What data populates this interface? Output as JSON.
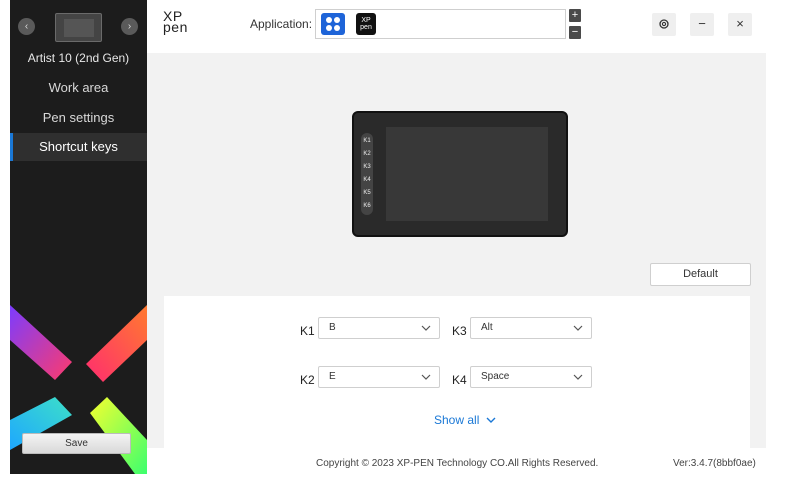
{
  "device": {
    "name": "Artist 10 (2nd Gen)",
    "prev_icon": "chevron-left-icon",
    "next_icon": "chevron-right-icon"
  },
  "sidebar": {
    "items": [
      {
        "label": "Work area",
        "active": false
      },
      {
        "label": "Pen settings",
        "active": false
      },
      {
        "label": "Shortcut keys",
        "active": true
      }
    ],
    "save_label": "Save"
  },
  "header": {
    "logo_line1": "XP",
    "logo_line2": "pen",
    "application_label": "Application:",
    "apps": [
      {
        "icon": "all-applications-icon"
      },
      {
        "icon": "xppen-app-icon",
        "text_line1": "XP",
        "text_line2": "pen"
      }
    ],
    "add_symbol": "+",
    "remove_symbol": "−",
    "settings_icon": "gear-icon",
    "minimize_symbol": "−",
    "close_symbol": "×"
  },
  "tablet": {
    "keys": [
      "K1",
      "K2",
      "K3",
      "K4",
      "K5",
      "K6"
    ]
  },
  "default_label": "Default",
  "shortcuts": {
    "k1": {
      "label": "K1",
      "value": "B"
    },
    "k2": {
      "label": "K2",
      "value": "E"
    },
    "k3": {
      "label": "K3",
      "value": "Alt"
    },
    "k4": {
      "label": "K4",
      "value": "Space"
    },
    "show_all_label": "Show all"
  },
  "footer": {
    "copyright": "Copyright © 2023  XP-PEN Technology CO.All Rights Reserved.",
    "version": "Ver:3.4.7(8bbf0ae)"
  },
  "colors": {
    "accent": "#1a78d6",
    "sidebar_bg": "#1c1c1c",
    "main_bg": "#f2f2f2"
  }
}
